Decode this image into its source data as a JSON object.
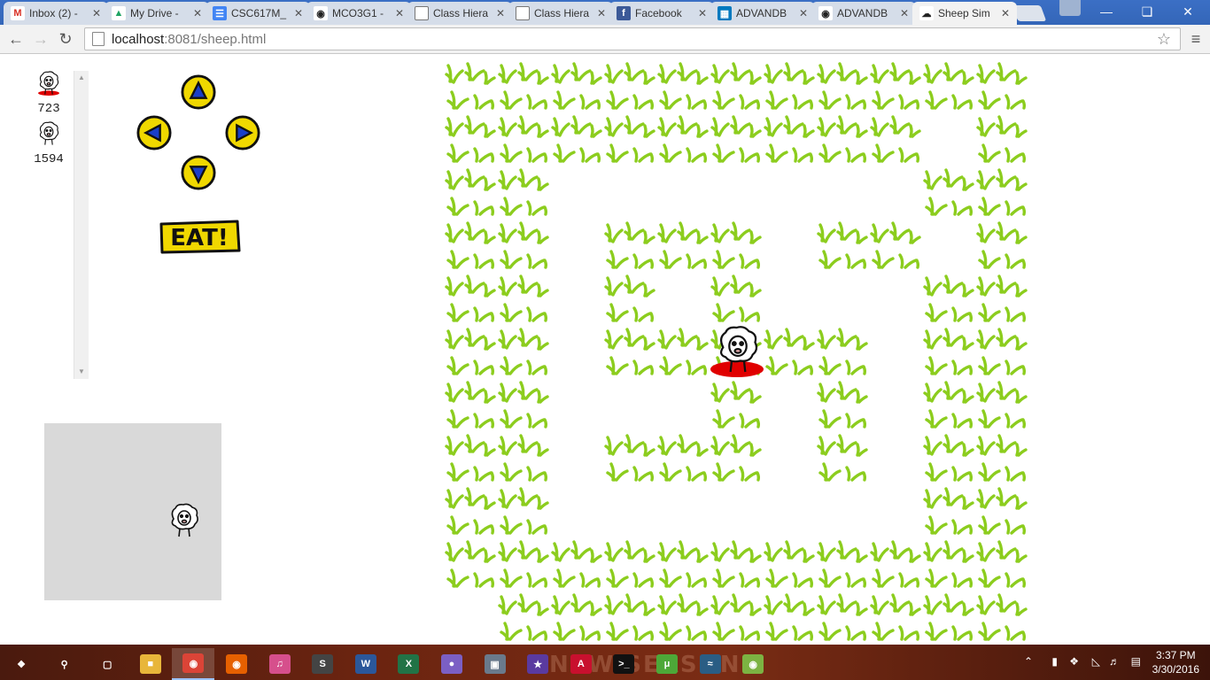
{
  "browser": {
    "tabs": [
      {
        "title": "Inbox (2) -",
        "icon": "gmail-icon",
        "active": false
      },
      {
        "title": "My Drive -",
        "icon": "drive-icon",
        "active": false
      },
      {
        "title": "CSC617M_",
        "icon": "docs-icon",
        "active": false
      },
      {
        "title": "MCO3G1 -",
        "icon": "github-icon",
        "active": false
      },
      {
        "title": "Class Hiera",
        "icon": "page-icon",
        "active": false
      },
      {
        "title": "Class Hiera",
        "icon": "page-icon",
        "active": false
      },
      {
        "title": "Facebook",
        "icon": "facebook-icon",
        "active": false
      },
      {
        "title": "ADVANDB",
        "icon": "trello-icon",
        "active": false
      },
      {
        "title": "ADVANDB",
        "icon": "github-icon",
        "active": false
      },
      {
        "title": "Sheep Sim",
        "icon": "sheep-icon",
        "active": true
      }
    ],
    "address": {
      "host": "localhost",
      "rest": ":8081/sheep.html"
    }
  },
  "game": {
    "players": [
      {
        "score": "723",
        "highlighted": true
      },
      {
        "score": "1594",
        "highlighted": false
      }
    ],
    "eat_label": "EAT!",
    "grass_color": "#8ccd1e",
    "button_color": "#f0d800",
    "arrow_color": "#1a3fc8"
  },
  "taskbar": {
    "apps": [
      "windows-icon",
      "search-icon",
      "task-view-icon",
      "file-explorer-icon",
      "chrome-icon",
      "firefox-icon",
      "itunes-icon",
      "sublime-icon",
      "word-icon",
      "excel-icon",
      "app-icon",
      "photos-icon",
      "game-icon",
      "acrobat-icon",
      "terminal-icon",
      "utorrent-icon",
      "mysql-icon",
      "android-icon"
    ],
    "banner": "NEW SEASON",
    "time": "3:37 PM",
    "date": "3/30/2016"
  }
}
